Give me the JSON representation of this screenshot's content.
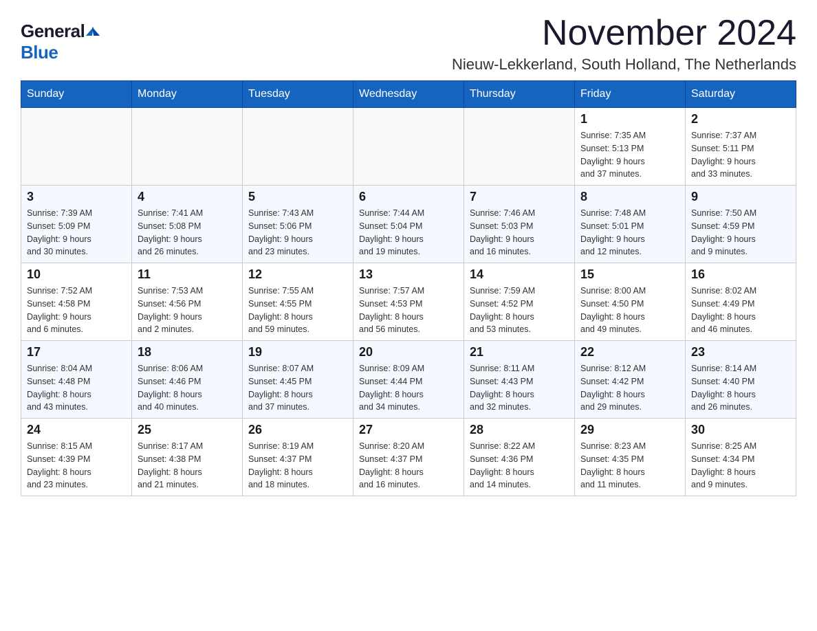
{
  "header": {
    "logo_general": "General",
    "logo_blue": "Blue",
    "month_title": "November 2024",
    "location": "Nieuw-Lekkerland, South Holland, The Netherlands"
  },
  "weekdays": [
    "Sunday",
    "Monday",
    "Tuesday",
    "Wednesday",
    "Thursday",
    "Friday",
    "Saturday"
  ],
  "weeks": [
    [
      {
        "day": "",
        "info": ""
      },
      {
        "day": "",
        "info": ""
      },
      {
        "day": "",
        "info": ""
      },
      {
        "day": "",
        "info": ""
      },
      {
        "day": "",
        "info": ""
      },
      {
        "day": "1",
        "info": "Sunrise: 7:35 AM\nSunset: 5:13 PM\nDaylight: 9 hours\nand 37 minutes."
      },
      {
        "day": "2",
        "info": "Sunrise: 7:37 AM\nSunset: 5:11 PM\nDaylight: 9 hours\nand 33 minutes."
      }
    ],
    [
      {
        "day": "3",
        "info": "Sunrise: 7:39 AM\nSunset: 5:09 PM\nDaylight: 9 hours\nand 30 minutes."
      },
      {
        "day": "4",
        "info": "Sunrise: 7:41 AM\nSunset: 5:08 PM\nDaylight: 9 hours\nand 26 minutes."
      },
      {
        "day": "5",
        "info": "Sunrise: 7:43 AM\nSunset: 5:06 PM\nDaylight: 9 hours\nand 23 minutes."
      },
      {
        "day": "6",
        "info": "Sunrise: 7:44 AM\nSunset: 5:04 PM\nDaylight: 9 hours\nand 19 minutes."
      },
      {
        "day": "7",
        "info": "Sunrise: 7:46 AM\nSunset: 5:03 PM\nDaylight: 9 hours\nand 16 minutes."
      },
      {
        "day": "8",
        "info": "Sunrise: 7:48 AM\nSunset: 5:01 PM\nDaylight: 9 hours\nand 12 minutes."
      },
      {
        "day": "9",
        "info": "Sunrise: 7:50 AM\nSunset: 4:59 PM\nDaylight: 9 hours\nand 9 minutes."
      }
    ],
    [
      {
        "day": "10",
        "info": "Sunrise: 7:52 AM\nSunset: 4:58 PM\nDaylight: 9 hours\nand 6 minutes."
      },
      {
        "day": "11",
        "info": "Sunrise: 7:53 AM\nSunset: 4:56 PM\nDaylight: 9 hours\nand 2 minutes."
      },
      {
        "day": "12",
        "info": "Sunrise: 7:55 AM\nSunset: 4:55 PM\nDaylight: 8 hours\nand 59 minutes."
      },
      {
        "day": "13",
        "info": "Sunrise: 7:57 AM\nSunset: 4:53 PM\nDaylight: 8 hours\nand 56 minutes."
      },
      {
        "day": "14",
        "info": "Sunrise: 7:59 AM\nSunset: 4:52 PM\nDaylight: 8 hours\nand 53 minutes."
      },
      {
        "day": "15",
        "info": "Sunrise: 8:00 AM\nSunset: 4:50 PM\nDaylight: 8 hours\nand 49 minutes."
      },
      {
        "day": "16",
        "info": "Sunrise: 8:02 AM\nSunset: 4:49 PM\nDaylight: 8 hours\nand 46 minutes."
      }
    ],
    [
      {
        "day": "17",
        "info": "Sunrise: 8:04 AM\nSunset: 4:48 PM\nDaylight: 8 hours\nand 43 minutes."
      },
      {
        "day": "18",
        "info": "Sunrise: 8:06 AM\nSunset: 4:46 PM\nDaylight: 8 hours\nand 40 minutes."
      },
      {
        "day": "19",
        "info": "Sunrise: 8:07 AM\nSunset: 4:45 PM\nDaylight: 8 hours\nand 37 minutes."
      },
      {
        "day": "20",
        "info": "Sunrise: 8:09 AM\nSunset: 4:44 PM\nDaylight: 8 hours\nand 34 minutes."
      },
      {
        "day": "21",
        "info": "Sunrise: 8:11 AM\nSunset: 4:43 PM\nDaylight: 8 hours\nand 32 minutes."
      },
      {
        "day": "22",
        "info": "Sunrise: 8:12 AM\nSunset: 4:42 PM\nDaylight: 8 hours\nand 29 minutes."
      },
      {
        "day": "23",
        "info": "Sunrise: 8:14 AM\nSunset: 4:40 PM\nDaylight: 8 hours\nand 26 minutes."
      }
    ],
    [
      {
        "day": "24",
        "info": "Sunrise: 8:15 AM\nSunset: 4:39 PM\nDaylight: 8 hours\nand 23 minutes."
      },
      {
        "day": "25",
        "info": "Sunrise: 8:17 AM\nSunset: 4:38 PM\nDaylight: 8 hours\nand 21 minutes."
      },
      {
        "day": "26",
        "info": "Sunrise: 8:19 AM\nSunset: 4:37 PM\nDaylight: 8 hours\nand 18 minutes."
      },
      {
        "day": "27",
        "info": "Sunrise: 8:20 AM\nSunset: 4:37 PM\nDaylight: 8 hours\nand 16 minutes."
      },
      {
        "day": "28",
        "info": "Sunrise: 8:22 AM\nSunset: 4:36 PM\nDaylight: 8 hours\nand 14 minutes."
      },
      {
        "day": "29",
        "info": "Sunrise: 8:23 AM\nSunset: 4:35 PM\nDaylight: 8 hours\nand 11 minutes."
      },
      {
        "day": "30",
        "info": "Sunrise: 8:25 AM\nSunset: 4:34 PM\nDaylight: 8 hours\nand 9 minutes."
      }
    ]
  ]
}
